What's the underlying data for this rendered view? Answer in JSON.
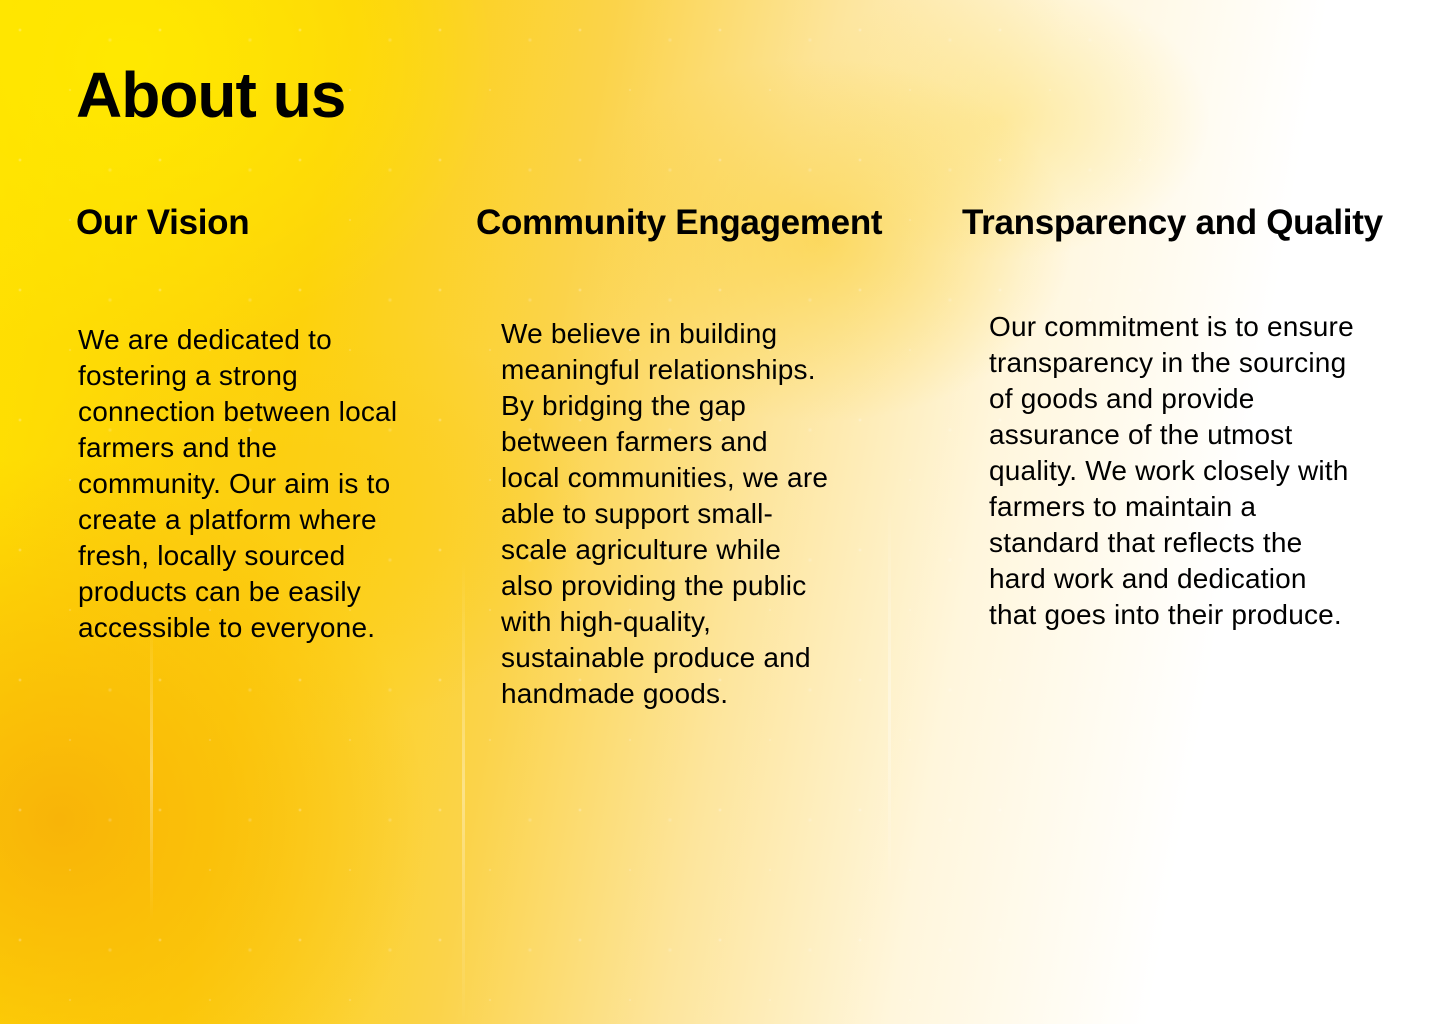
{
  "page": {
    "title": "About us"
  },
  "sections": [
    {
      "heading": "Our Vision",
      "text": "We are dedicated to fostering a strong connection between local farmers and the community. Our aim is to create a platform where fresh, locally sourced products can be easily accessible to everyone."
    },
    {
      "heading": "Community Engagement",
      "text": "We believe in building meaningful relationships. By bridging the gap between farmers and local communities, we are able to support small-scale agriculture while also providing the public with high-quality, sustainable produce and handmade goods."
    },
    {
      "heading": "Transparency and Quality",
      "text": "Our commitment is to ensure transparency in the sourcing of goods and provide assurance of the utmost quality. We work closely with farmers to maintain a standard that reflects the hard work and dedication that goes into their produce."
    }
  ],
  "colors": {
    "text": "#000000",
    "accent_yellow": "#ffe100",
    "accent_orange": "#f8b208",
    "background_light": "#ffffff"
  }
}
